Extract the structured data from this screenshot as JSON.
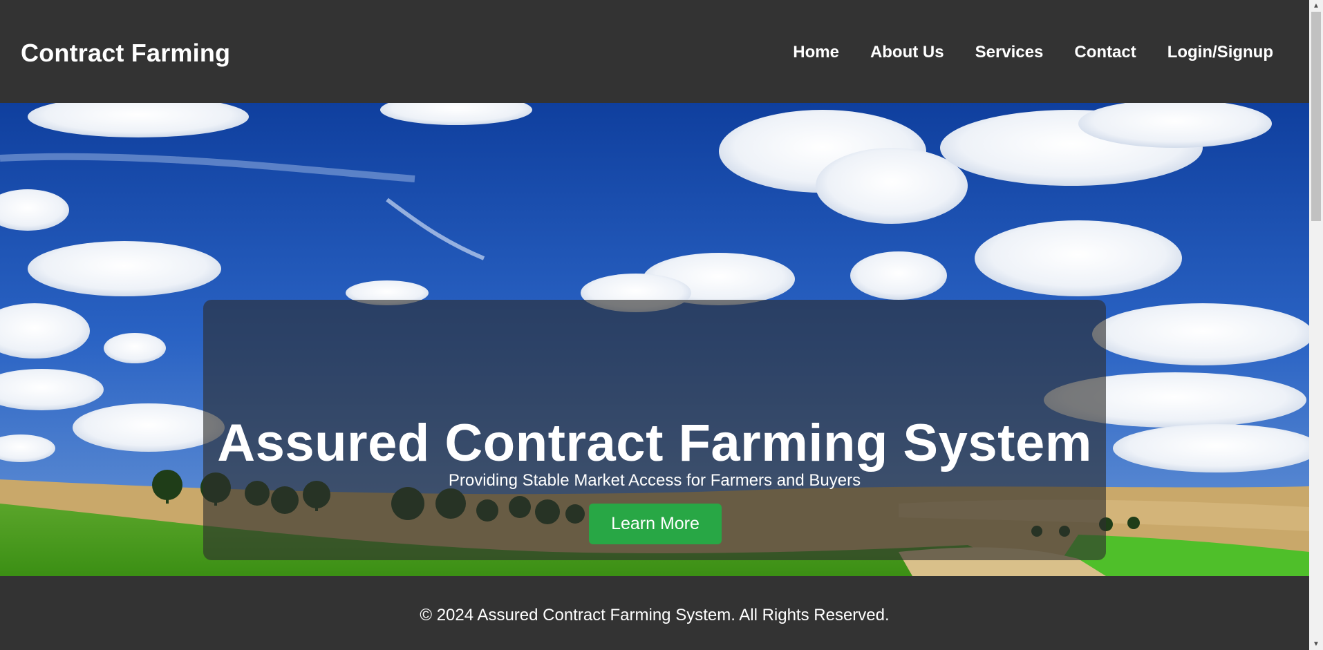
{
  "header": {
    "brand": "Contract Farming",
    "nav": [
      "Home",
      "About Us",
      "Services",
      "Contact",
      "Login/Signup"
    ]
  },
  "hero": {
    "title": "Assured Contract Farming System",
    "subtitle": "Providing Stable Market Access for Farmers and Buyers",
    "button_label": "Learn More"
  },
  "footer": {
    "text": "© 2024 Assured Contract Farming System. All Rights Reserved."
  },
  "colors": {
    "header_bg": "#333333",
    "button_bg": "#28a745",
    "sky": "#1b55b8",
    "field_green": "#3fa51c"
  }
}
